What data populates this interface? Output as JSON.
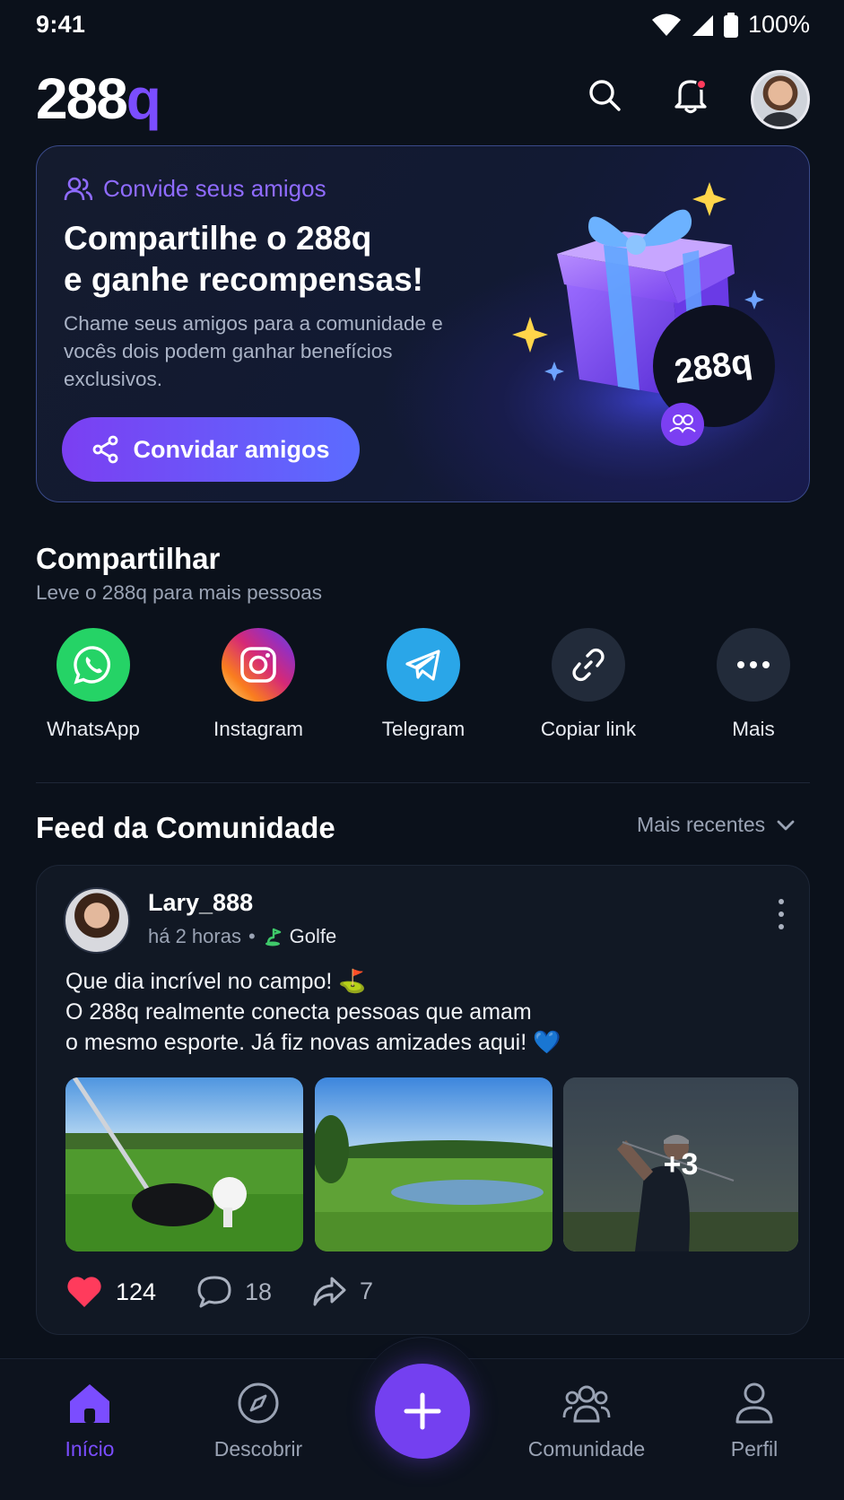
{
  "status_bar": {
    "time": "9:41",
    "battery": "100%"
  },
  "header": {
    "logo_main": "288",
    "logo_accent": "q"
  },
  "invite": {
    "tag": "Convide seus amigos",
    "title_line1": "Compartilhe o 288q",
    "title_line2": "e ganhe recompensas!",
    "description": "Chame seus amigos para a comunidade e vocês dois podem ganhar benefícios exclusivos.",
    "button": "Convidar amigos",
    "badge_text": "288q"
  },
  "share": {
    "title": "Compartilhar",
    "subtitle": "Leve o 288q para mais pessoas",
    "items": [
      {
        "label": "WhatsApp",
        "icon": "whatsapp-icon",
        "color": "#25d366"
      },
      {
        "label": "Instagram",
        "icon": "instagram-icon",
        "color": "#e1306c"
      },
      {
        "label": "Telegram",
        "icon": "telegram-icon",
        "color": "#2aa6e8"
      },
      {
        "label": "Copiar link",
        "icon": "link-icon",
        "color": "#222b3a"
      },
      {
        "label": "Mais",
        "icon": "more-icon",
        "color": "#222b3a"
      }
    ]
  },
  "feed": {
    "title": "Feed da Comunidade",
    "sort_label": "Mais recentes",
    "post": {
      "username": "Lary_888",
      "time": "há 2 horas",
      "sport": "Golfe",
      "text": "Que dia incrível no campo! ⛳\nO 288q realmente conecta pessoas que amam\no mesmo esporte. Já fiz novas amizades aqui! 💙",
      "more_images": "+3",
      "likes": "124",
      "comments": "18",
      "shares": "7"
    }
  },
  "nav": {
    "items": [
      {
        "label": "Início",
        "icon": "home-icon",
        "active": true
      },
      {
        "label": "Descobrir",
        "icon": "compass-icon"
      },
      {
        "label": "Comunidade",
        "icon": "community-icon"
      },
      {
        "label": "Perfil",
        "icon": "profile-icon"
      }
    ]
  },
  "colors": {
    "accent": "#7b4dff",
    "background": "#0b111b",
    "like": "#ff3b5c"
  }
}
